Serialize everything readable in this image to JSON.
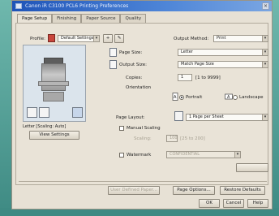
{
  "window": {
    "title": "Canon iR C3100 PCL6 Printing Preferences",
    "close_glyph": "×"
  },
  "tabs": [
    {
      "label": "Page Setup"
    },
    {
      "label": "Finishing"
    },
    {
      "label": "Paper Source"
    },
    {
      "label": "Quality"
    }
  ],
  "profile": {
    "label": "Profile:",
    "value": "Default Settings"
  },
  "output_method": {
    "label": "Output Method:",
    "value": "Print"
  },
  "page_size": {
    "label": "Page Size:",
    "value": "Letter"
  },
  "output_size": {
    "label": "Output Size:",
    "value": "Match Page Size"
  },
  "copies": {
    "label": "Copies:",
    "value": "1",
    "range": "[1 to 9999]"
  },
  "orientation": {
    "label": "Orientation",
    "portrait": "Portrait",
    "landscape": "Landscape"
  },
  "page_layout": {
    "label": "Page Layout:",
    "value": "1 Page per Sheet"
  },
  "manual_scaling": {
    "label": "Manual Scaling"
  },
  "scaling": {
    "label": "Scaling:",
    "value": "100",
    "range": "[25 to 200]"
  },
  "watermark": {
    "label": "Watermark",
    "value": "CONFIDENTIAL"
  },
  "preview_caption": "Letter [Scaling: Auto]",
  "view_settings_label": "View Settings",
  "bottom_buttons": {
    "user_defined": "User Defined Paper...",
    "page_options": "Page Options...",
    "restore_defaults": "Restore Defaults"
  },
  "dialog_buttons": {
    "ok": "OK",
    "cancel": "Cancel",
    "help": "Help"
  }
}
